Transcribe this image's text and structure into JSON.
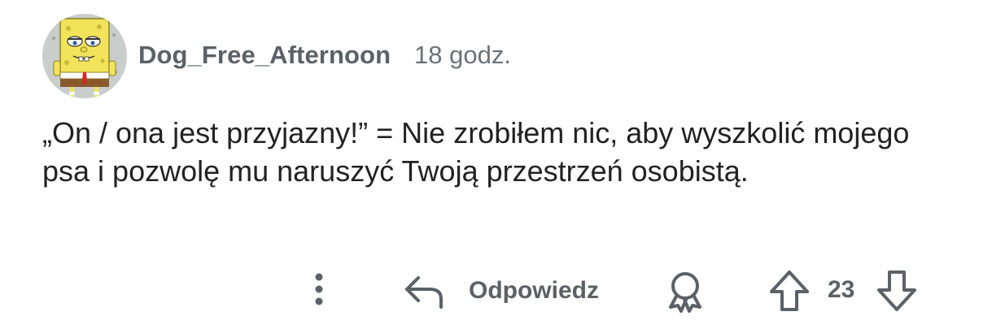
{
  "comment": {
    "author": "Dog_Free_Afternoon",
    "timestamp": "18 godz.",
    "avatar_icon": "spongebob-avatar",
    "body": "„On / ona jest przyjazny!” = Nie zrobiłem nic, aby wyszkolić mojego psa i pozwolę mu naruszyć Twoją przestrzeń osobistą."
  },
  "actions": {
    "more_icon": "more-vertical-icon",
    "reply_icon": "reply-arrow-icon",
    "reply_label": "Odpowiedz",
    "award_icon": "award-icon",
    "upvote_icon": "upvote-arrow-icon",
    "vote_count": "23",
    "downvote_icon": "downvote-arrow-icon"
  },
  "colors": {
    "text_primary": "#222222",
    "text_secondary": "#5b6166",
    "icon": "#5b6166",
    "background": "#ffffff"
  }
}
